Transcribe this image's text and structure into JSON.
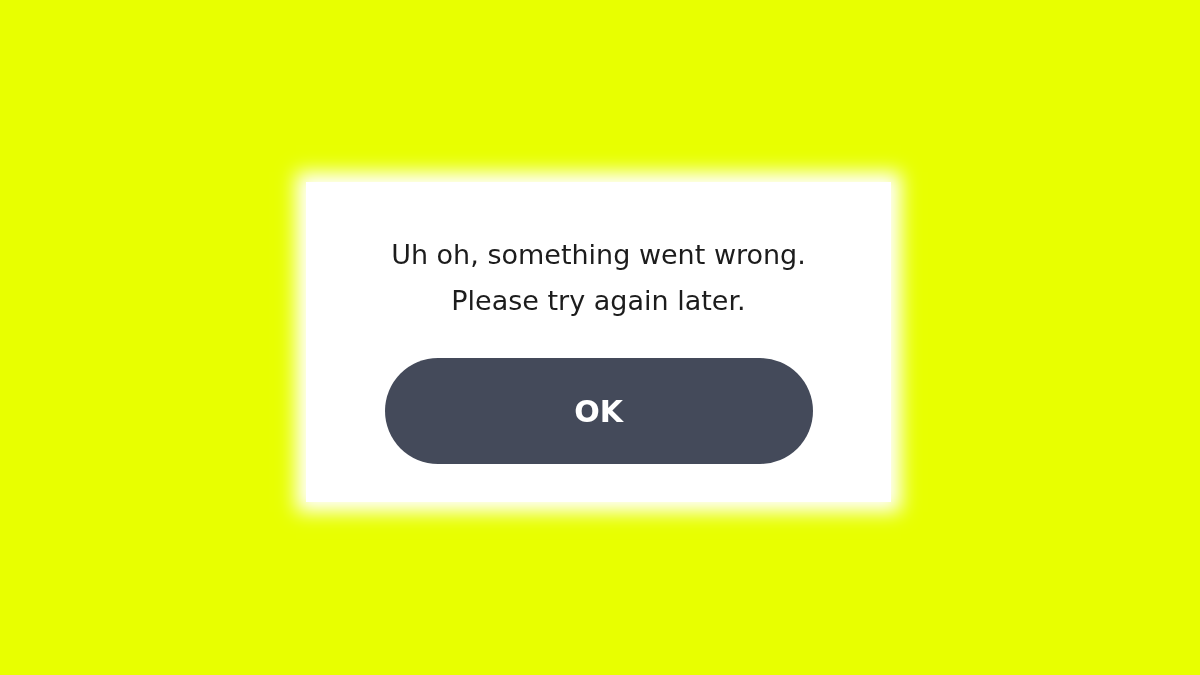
{
  "dialog": {
    "message_lines": [
      "Uh oh, something went wrong.",
      "Please try again later."
    ],
    "button": "OK"
  }
}
